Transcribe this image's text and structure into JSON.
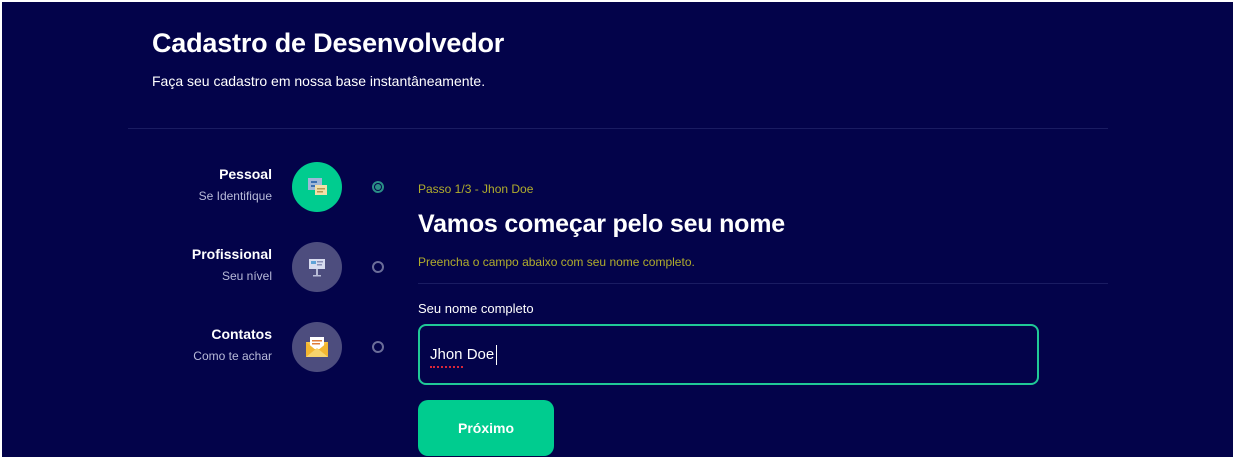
{
  "header": {
    "title": "Cadastro de Desenvolvedor",
    "subtitle": "Faça seu cadastro em nossa base instantâneamente."
  },
  "steps": [
    {
      "label": "Pessoal",
      "sub": "Se Identifique",
      "icon": "id-card-icon",
      "active": true
    },
    {
      "label": "Profissional",
      "sub": "Seu nível",
      "icon": "desk-icon",
      "active": false
    },
    {
      "label": "Contatos",
      "sub": "Como te achar",
      "icon": "envelope-icon",
      "active": false
    }
  ],
  "form": {
    "step_tag": "Passo 1/3 - Jhon Doe",
    "title": "Vamos começar pelo seu nome",
    "description": "Preencha o campo abaixo com seu nome completo.",
    "field_label": "Seu nome completo",
    "field_value": "Jhon Doe",
    "next_label": "Próximo"
  },
  "colors": {
    "background": "#03034a",
    "accent": "#00cc8f",
    "muted_step": "#4d4d7e",
    "hint": "#b1ad2c"
  }
}
